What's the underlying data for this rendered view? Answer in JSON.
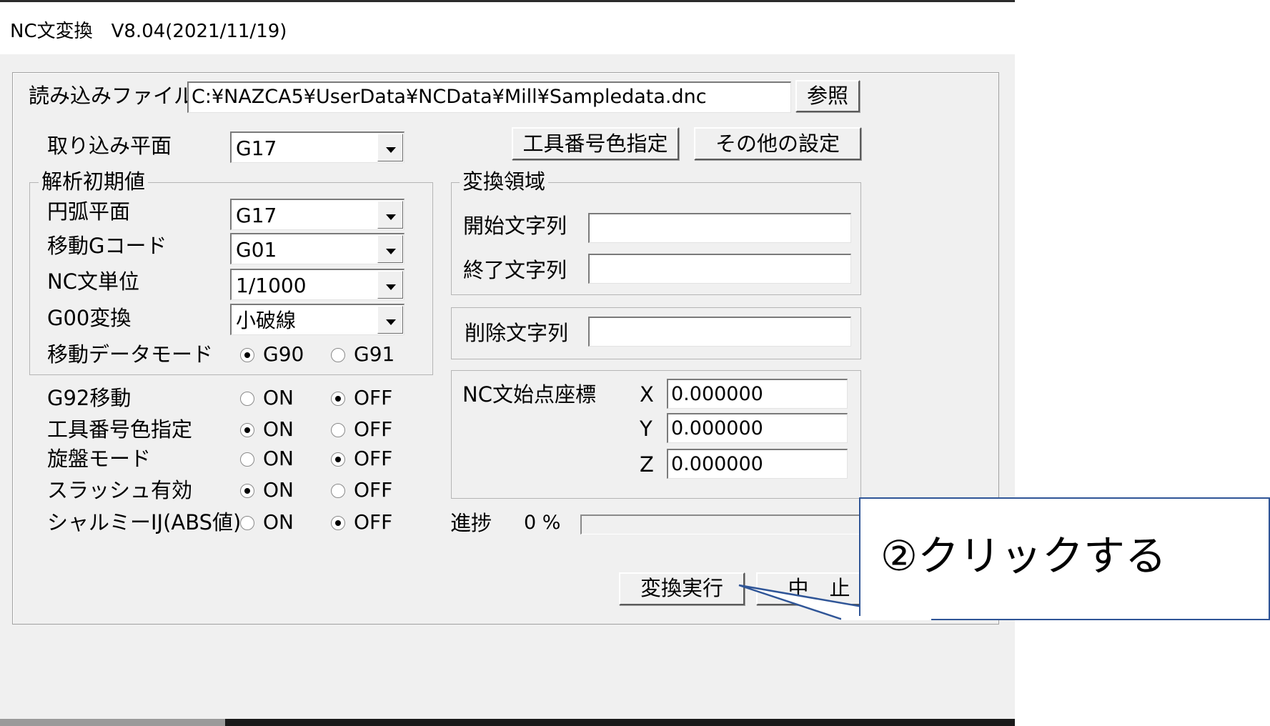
{
  "window": {
    "title": "NC文変換　V8.04(2021/11/19)"
  },
  "file": {
    "label": "読み込みファイル",
    "value": "C:¥NAZCA5¥UserData¥NCData¥Mill¥Sampledata.dnc",
    "browse_label": "参照"
  },
  "plane": {
    "label": "取り込み平面",
    "value": "G17"
  },
  "buttons": {
    "tool_color": "工具番号色指定",
    "other_settings": "その他の設定",
    "execute": "変換実行",
    "cancel": "中　止"
  },
  "analysis": {
    "title": "解析初期値",
    "arc_plane_label": "円弧平面",
    "arc_plane_value": "G17",
    "move_gcode_label": "移動Gコード",
    "move_gcode_value": "G01",
    "unit_label": "NC文単位",
    "unit_value": "1/1000",
    "g00_label": "G00変換",
    "g00_value": "小破線",
    "move_mode_label": "移動データモード",
    "opt_g90": "G90",
    "opt_g91": "G91",
    "selected_mode": "G90"
  },
  "options": {
    "on": "ON",
    "off": "OFF",
    "rows": [
      {
        "label": "G92移動",
        "selected": "OFF"
      },
      {
        "label": "工具番号色指定",
        "selected": "ON"
      },
      {
        "label": "旋盤モード",
        "selected": "OFF"
      },
      {
        "label": "スラッシュ有効",
        "selected": "ON"
      },
      {
        "label": "シャルミーIJ(ABS値)",
        "selected": "OFF"
      }
    ]
  },
  "region": {
    "title": "変換領域",
    "start_label": "開始文字列",
    "start_value": "",
    "end_label": "終了文字列",
    "end_value": ""
  },
  "delete": {
    "label": "削除文字列",
    "value": ""
  },
  "coords": {
    "label": "NC文始点座標",
    "x_label": "X",
    "x_value": "0.000000",
    "y_label": "Y",
    "y_value": "0.000000",
    "z_label": "Z",
    "z_value": "0.000000"
  },
  "progress": {
    "label": "進捗",
    "value_text": "0 %",
    "percent": 0
  },
  "callout": {
    "text": "②クリックする",
    "border_color": "#2f5597"
  }
}
